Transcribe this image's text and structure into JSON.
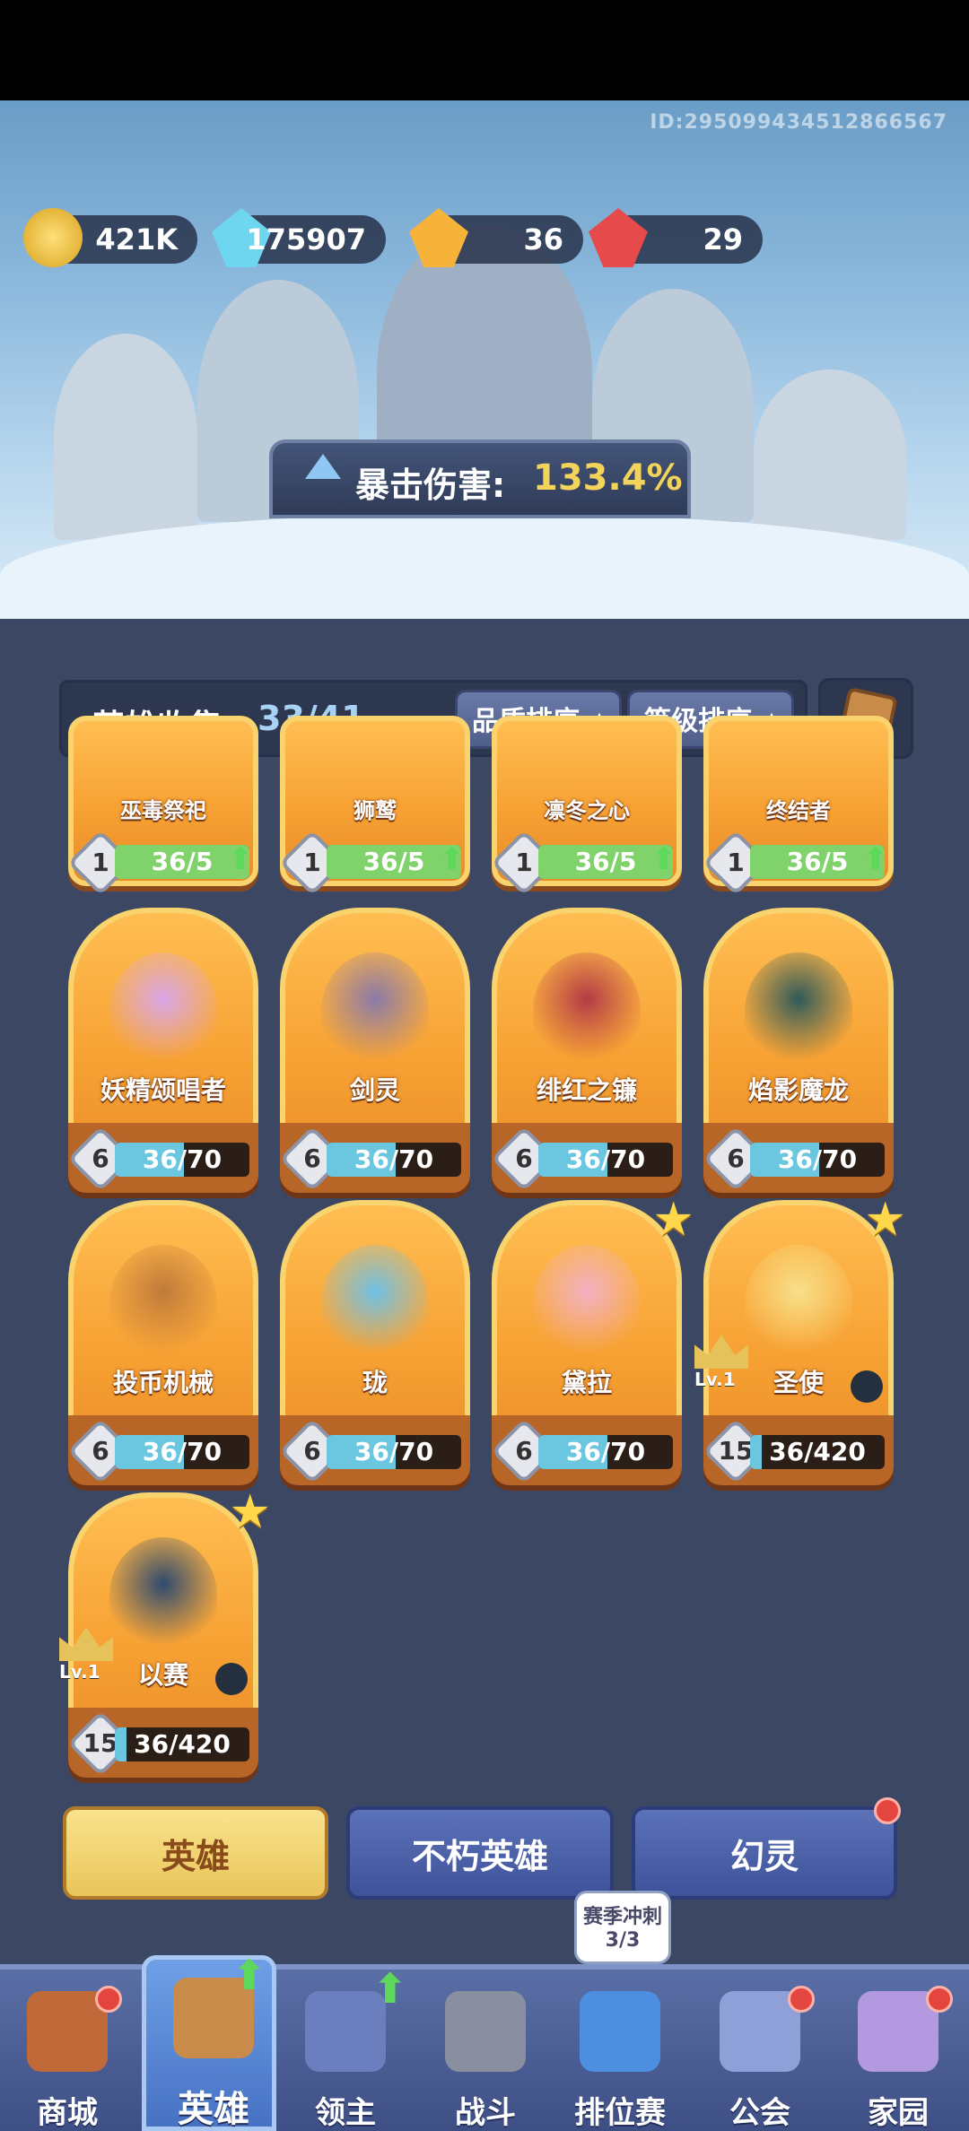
{
  "player_id": "ID:2950994345128665​67",
  "currencies": [
    {
      "icon": "gold-coin-icon",
      "value": "421K"
    },
    {
      "icon": "blue-crystal-icon",
      "value": "175907"
    },
    {
      "icon": "orange-gem-icon",
      "value": "36"
    },
    {
      "icon": "red-gem-icon",
      "value": "29"
    }
  ],
  "crit": {
    "label": "暴击伤害:",
    "value": "133.4%"
  },
  "collection": {
    "title": "英雄收集:",
    "count": "33/41",
    "sort_quality": "品质排序",
    "sort_level": "等级排序"
  },
  "top_row": [
    {
      "name": "巫毒祭祀",
      "level": "1",
      "progress": "36/5"
    },
    {
      "name": "狮鹫",
      "level": "1",
      "progress": "36/5"
    },
    {
      "name": "凛冬之心",
      "level": "1",
      "progress": "36/5"
    },
    {
      "name": "终结者",
      "level": "1",
      "progress": "36/5"
    }
  ],
  "heroes": [
    {
      "name": "妖精颂唱者",
      "level": "6",
      "progress": "36/70",
      "fill": 0.514,
      "color": "#d9a6e8"
    },
    {
      "name": "剑灵",
      "level": "6",
      "progress": "36/70",
      "fill": 0.514,
      "color": "#8a7aa8"
    },
    {
      "name": "绯红之镰",
      "level": "6",
      "progress": "36/70",
      "fill": 0.514,
      "color": "#b33b45"
    },
    {
      "name": "焰影魔龙",
      "level": "6",
      "progress": "36/70",
      "fill": 0.514,
      "color": "#2f5a5a"
    },
    {
      "name": "投币机械",
      "level": "6",
      "progress": "36/70",
      "fill": 0.514,
      "color": "#c07a3a"
    },
    {
      "name": "珑",
      "level": "6",
      "progress": "36/70",
      "fill": 0.514,
      "color": "#6fc0e6"
    },
    {
      "name": "黛拉",
      "level": "6",
      "progress": "36/70",
      "fill": 0.514,
      "color": "#f2b0c4"
    },
    {
      "name": "圣使",
      "level": "15",
      "progress": "36/420",
      "fill": 0.086,
      "color": "#f7e08a"
    },
    {
      "name": "以赛",
      "level": "15",
      "progress": "36/420",
      "fill": 0.086,
      "color": "#2f4a6e"
    }
  ],
  "badge_lv": "Lv.1",
  "tabs": {
    "hero": "英雄",
    "immortal": "不朽英雄",
    "phantom": "幻灵"
  },
  "season": {
    "line1": "赛季冲刺",
    "line2": "3/3"
  },
  "nav": [
    "商城",
    "英雄",
    "领主",
    "战斗",
    "排位赛",
    "公会",
    "家园"
  ]
}
